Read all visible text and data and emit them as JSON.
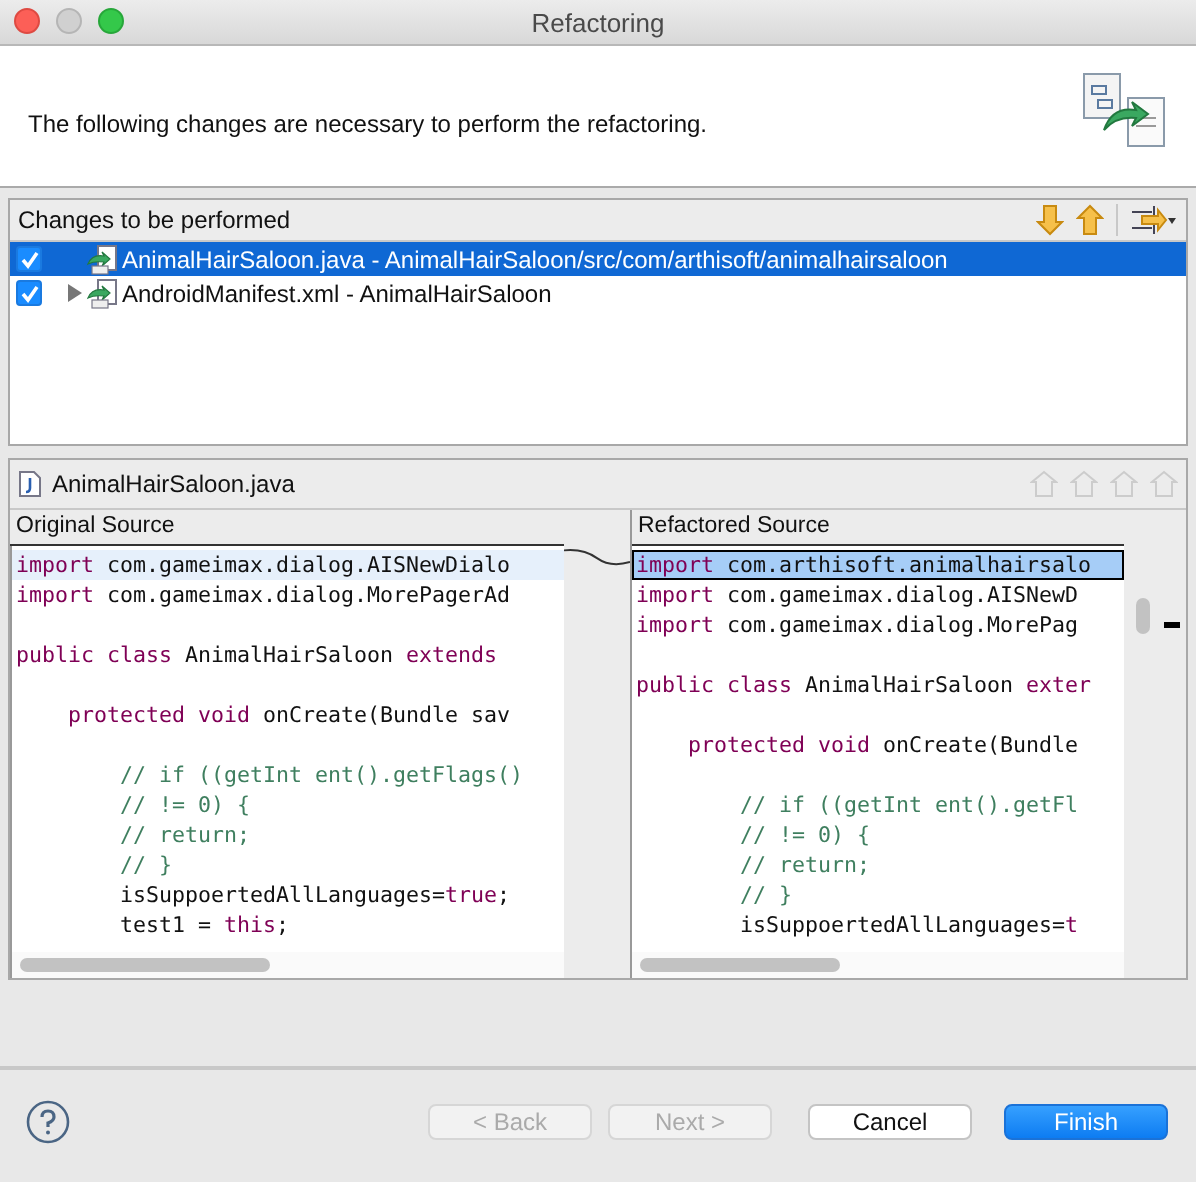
{
  "window": {
    "title": "Refactoring"
  },
  "header": {
    "message": "The following changes are necessary to perform the refactoring."
  },
  "changes": {
    "title": "Changes to be performed",
    "items": [
      {
        "label": "AnimalHairSaloon.java - AnimalHairSaloon/src/com/arthisoft/animalhairsaloon",
        "checked": true,
        "selected": true,
        "expandable": false
      },
      {
        "label": "AndroidManifest.xml - AnimalHairSaloon",
        "checked": true,
        "selected": false,
        "expandable": true
      }
    ]
  },
  "compare": {
    "file": "AnimalHairSaloon.java",
    "left": {
      "title": "Original Source",
      "lines": [
        {
          "highlighted": true,
          "segments": [
            {
              "kind": "keyword",
              "text": "import"
            },
            {
              "kind": "text",
              "text": " com.gameimax.dialog.AISNewDialo"
            }
          ]
        },
        {
          "highlighted": false,
          "segments": [
            {
              "kind": "keyword",
              "text": "import"
            },
            {
              "kind": "text",
              "text": " com.gameimax.dialog.MorePagerAd"
            }
          ]
        },
        {
          "highlighted": false
        },
        {
          "highlighted": false,
          "segments": [
            {
              "kind": "keyword",
              "text": "public class"
            },
            {
              "kind": "text",
              "text": " AnimalHairSaloon "
            },
            {
              "kind": "keyword",
              "text": "extends"
            }
          ]
        },
        {
          "highlighted": false
        },
        {
          "highlighted": false,
          "segments": [
            {
              "kind": "keyword",
              "text": "    protected void"
            },
            {
              "kind": "text",
              "text": " onCreate(Bundle sav"
            }
          ]
        },
        {
          "highlighted": false
        },
        {
          "highlighted": false,
          "segments": [
            {
              "kind": "comment",
              "text": "        // if ((getInt ent().getFlags()"
            }
          ]
        },
        {
          "highlighted": false,
          "segments": [
            {
              "kind": "comment",
              "text": "        // != 0) {"
            }
          ]
        },
        {
          "highlighted": false,
          "segments": [
            {
              "kind": "comment",
              "text": "        // return;"
            }
          ]
        },
        {
          "highlighted": false,
          "segments": [
            {
              "kind": "comment",
              "text": "        // }"
            }
          ]
        },
        {
          "highlighted": false,
          "segments": [
            {
              "kind": "text",
              "text": "        isSuppoertedAllLanguages="
            },
            {
              "kind": "keyword",
              "text": "true"
            },
            {
              "kind": "text",
              "text": ";"
            }
          ]
        },
        {
          "highlighted": false,
          "segments": [
            {
              "kind": "text",
              "text": "        test1 = "
            },
            {
              "kind": "keyword",
              "text": "this"
            },
            {
              "kind": "text",
              "text": ";"
            }
          ]
        }
      ]
    },
    "right": {
      "title": "Refactored Source",
      "lines": [
        {
          "highlighted": true,
          "segments": [
            {
              "kind": "keyword",
              "text": "import"
            },
            {
              "kind": "text",
              "text": " com.arthisoft.animalhairsalo"
            }
          ]
        },
        {
          "highlighted": false,
          "segments": [
            {
              "kind": "keyword",
              "text": "import"
            },
            {
              "kind": "text",
              "text": " com.gameimax.dialog.AISNewD"
            }
          ]
        },
        {
          "highlighted": false,
          "segments": [
            {
              "kind": "keyword",
              "text": "import"
            },
            {
              "kind": "text",
              "text": " com.gameimax.dialog.MorePag"
            }
          ]
        },
        {
          "highlighted": false
        },
        {
          "highlighted": false,
          "segments": [
            {
              "kind": "keyword",
              "text": "public class"
            },
            {
              "kind": "text",
              "text": " AnimalHairSaloon "
            },
            {
              "kind": "keyword",
              "text": "exter"
            }
          ]
        },
        {
          "highlighted": false
        },
        {
          "highlighted": false,
          "segments": [
            {
              "kind": "keyword",
              "text": "    protected void"
            },
            {
              "kind": "text",
              "text": " onCreate(Bundle"
            }
          ]
        },
        {
          "highlighted": false
        },
        {
          "highlighted": false,
          "segments": [
            {
              "kind": "comment",
              "text": "        // if ((getInt ent().getFl"
            }
          ]
        },
        {
          "highlighted": false,
          "segments": [
            {
              "kind": "comment",
              "text": "        // != 0) {"
            }
          ]
        },
        {
          "highlighted": false,
          "segments": [
            {
              "kind": "comment",
              "text": "        // return;"
            }
          ]
        },
        {
          "highlighted": false,
          "segments": [
            {
              "kind": "comment",
              "text": "        // }"
            }
          ]
        },
        {
          "highlighted": false,
          "segments": [
            {
              "kind": "text",
              "text": "        isSuppoertedAllLanguages="
            },
            {
              "kind": "keyword",
              "text": "t"
            }
          ]
        }
      ]
    }
  },
  "buttons": [
    {
      "label": "< Back",
      "disabled": true,
      "default": false
    },
    {
      "label": "Next >",
      "disabled": true,
      "default": false
    },
    {
      "label": "Cancel",
      "disabled": false,
      "default": false
    },
    {
      "label": "Finish",
      "disabled": false,
      "default": true
    }
  ]
}
